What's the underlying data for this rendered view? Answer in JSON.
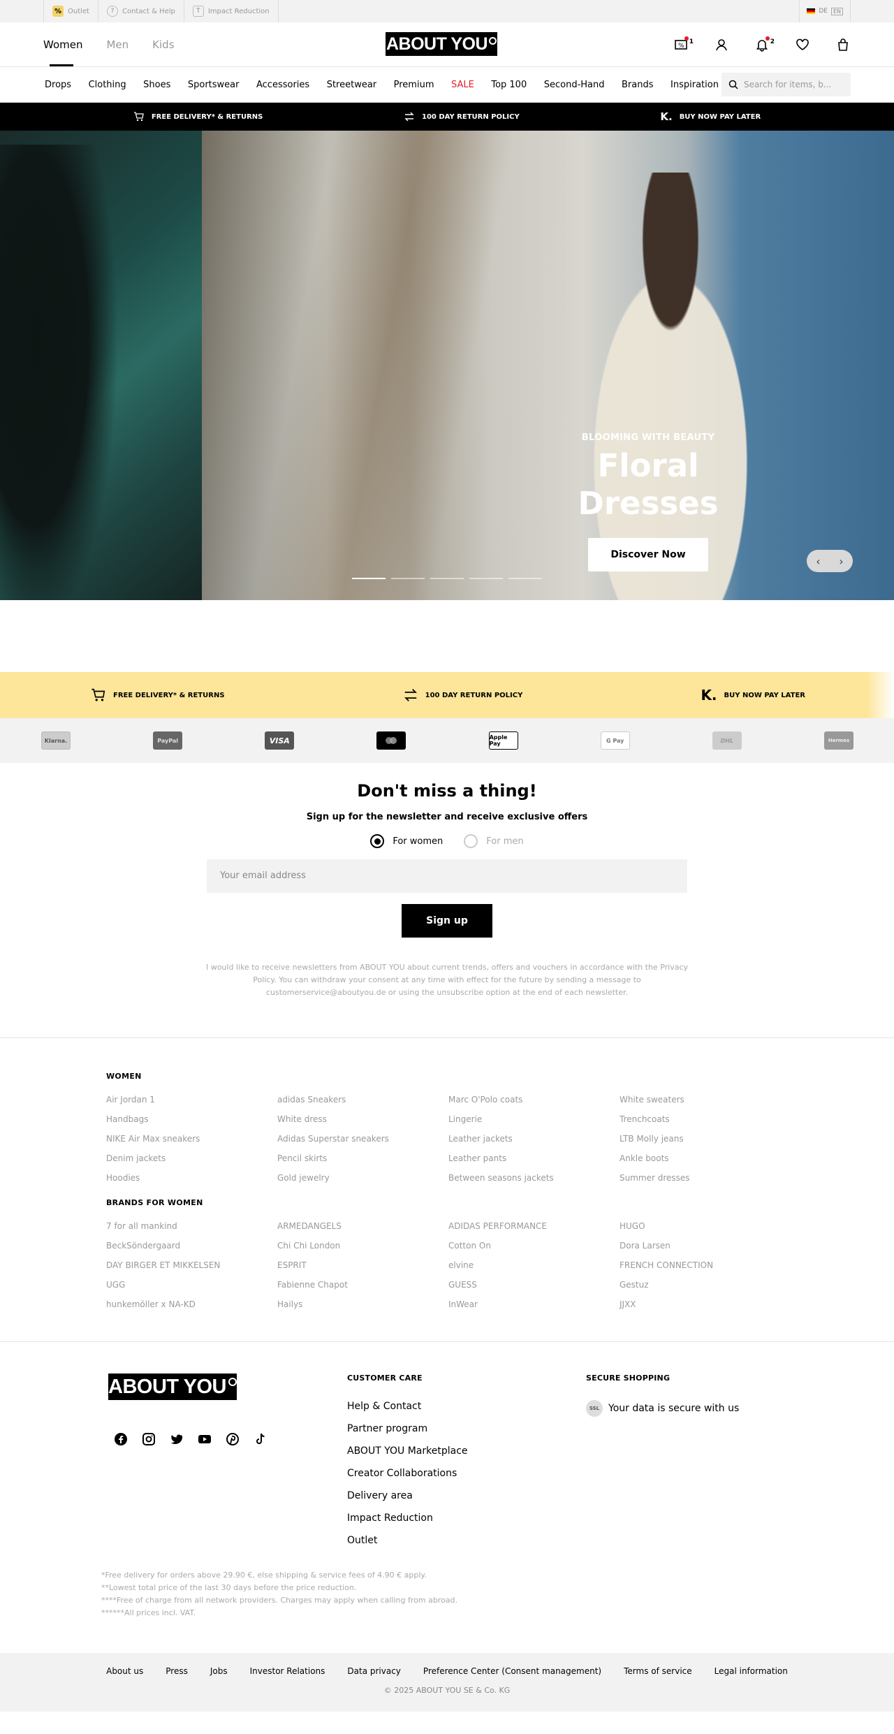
{
  "utility": {
    "outlet": "Outlet",
    "contact": "Contact & Help",
    "impact": "Impact Reduction",
    "lang_de": "DE",
    "lang_en": "EN"
  },
  "header": {
    "genders": [
      "Women",
      "Men",
      "Kids"
    ],
    "logo": "ABOUT YOU",
    "notification_count": "2",
    "offers_count": "1"
  },
  "nav": {
    "items": [
      "Drops",
      "Clothing",
      "Shoes",
      "Sportswear",
      "Accessories",
      "Streetwear",
      "Premium",
      "SALE",
      "Top 100",
      "Second-Hand",
      "Brands",
      "Inspiration"
    ],
    "search_placeholder": "Search for items, b..."
  },
  "usps": {
    "delivery": "FREE DELIVERY* & RETURNS",
    "returns": "100 DAY RETURN POLICY",
    "pay_later": "BUY NOW PAY LATER"
  },
  "hero": {
    "eyebrow": "BLOOMING WITH BEAUTY",
    "title": "Floral Dresses",
    "cta": "Discover Now"
  },
  "payments": [
    "Klarna.",
    "PayPal",
    "VISA",
    "Mastercard",
    "Apple Pay",
    "G Pay",
    "DHL",
    "Hermes"
  ],
  "newsletter": {
    "title": "Don't miss a thing!",
    "subtitle": "Sign up for the newsletter and receive exclusive offers",
    "option_women": "For women",
    "option_men": "For men",
    "email_placeholder": "Your email address",
    "signup": "Sign up",
    "legal_1": "I would like to receive newsletters from ABOUT YOU about current trends, offers and vouchers in accordance with the",
    "privacy_link": "Privacy Policy",
    "legal_2": ". You can withdraw your consent at any time with effect for the future by sending a message to",
    "email_link": "customerservice@aboutyou.de",
    "legal_3": " or using the unsubscribe option at the end of each newsletter."
  },
  "seo": {
    "women_title": "WOMEN",
    "women": [
      "Air Jordan 1",
      "adidas Sneakers",
      "Marc O'Polo coats",
      "White sweaters",
      "Handbags",
      "White dress",
      "Lingerie",
      "Trenchcoats",
      "NIKE Air Max sneakers",
      "Adidas Superstar sneakers",
      "Leather jackets",
      "LTB Molly jeans",
      "Denim jackets",
      "Pencil skirts",
      "Leather pants",
      "Ankle boots",
      "Hoodies",
      "Gold jewelry",
      "Between seasons jackets",
      "Summer dresses"
    ],
    "brands_title": "BRANDS FOR WOMEN",
    "brands": [
      "7 for all mankind",
      "ARMEDANGELS",
      "ADIDAS PERFORMANCE",
      "HUGO",
      "BeckSöndergaard",
      "Chi Chi London",
      "Cotton On",
      "Dora Larsen",
      "DAY BIRGER ET MIKKELSEN",
      "ESPRIT",
      "elvine",
      "FRENCH CONNECTION",
      "UGG",
      "Fabienne Chapot",
      "GUESS",
      "Gestuz",
      "hunkemöller x NA-KD",
      "Hailys",
      "InWear",
      "JJXX"
    ]
  },
  "footer": {
    "logo": "ABOUT YOU",
    "care_title": "CUSTOMER CARE",
    "care_links": [
      "Help & Contact",
      "Partner program",
      "ABOUT YOU Marketplace",
      "Creator Collaborations",
      "Delivery area",
      "Impact Reduction",
      "Outlet"
    ],
    "secure_title": "SECURE SHOPPING",
    "secure_text": "Your data is secure with us",
    "secure_badge": "SSL",
    "notes": [
      "*Free delivery for orders above 29.90 €, else shipping & service fees of 4.90 € apply.",
      "**Lowest total price of the last 30 days before the price reduction.",
      "****Free of charge from all network providers. Charges may apply when calling from abroad.",
      "******All prices incl. VAT."
    ]
  },
  "bottom": {
    "links": [
      "About us",
      "Press",
      "Jobs",
      "Investor Relations",
      "Data privacy",
      "Preference Center (Consent management)",
      "Terms of service",
      "Legal information"
    ],
    "copyright": "© 2025 ABOUT YOU SE & Co. KG"
  },
  "colors": {
    "sale": "#e51c23",
    "usp_yellow": "#fde599",
    "black": "#000000"
  }
}
